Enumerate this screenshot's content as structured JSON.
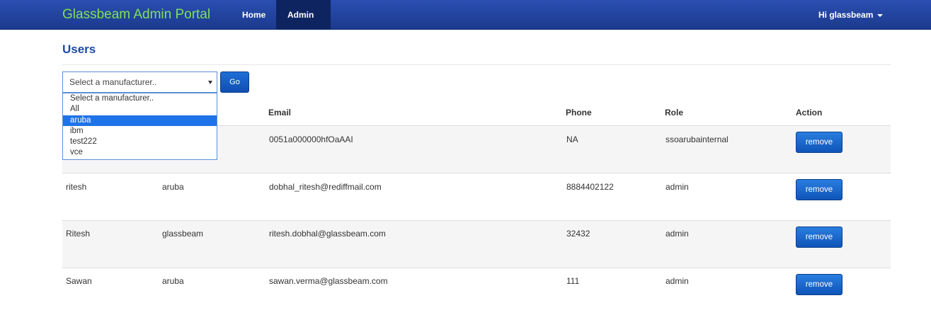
{
  "nav": {
    "brand": "Glassbeam Admin Portal",
    "home": "Home",
    "admin": "Admin",
    "user": "Hi glassbeam"
  },
  "page": {
    "title": "Users"
  },
  "filter": {
    "select_value": "Select a manufacturer..",
    "go_label": "Go",
    "options": [
      "Select a manufacturer..",
      "All",
      "aruba",
      "ibm",
      "test222",
      "vce"
    ],
    "highlighted_option": "aruba"
  },
  "table": {
    "headers": {
      "email": "Email",
      "phone": "Phone",
      "role": "Role",
      "action": "Action"
    },
    "rows": [
      {
        "name": "",
        "company": "",
        "email": "0051a000000hfOaAAI",
        "phone": "NA",
        "role": "ssoarubainternal",
        "action": "remove"
      },
      {
        "name": "ritesh",
        "company": "aruba",
        "email": "dobhal_ritesh@rediffmail.com",
        "phone": "8884402122",
        "role": "admin",
        "action": "remove"
      },
      {
        "name": "Ritesh",
        "company": "glassbeam",
        "email": "ritesh.dobhal@glassbeam.com",
        "phone": "32432",
        "role": "admin",
        "action": "remove"
      },
      {
        "name": "Sawan",
        "company": "aruba",
        "email": "sawan.verma@glassbeam.com",
        "phone": "111",
        "role": "admin",
        "action": "remove"
      }
    ]
  },
  "colors": {
    "navbar": "#1f4aa3",
    "brand": "#7fe05a",
    "accent": "#1e73e8"
  }
}
